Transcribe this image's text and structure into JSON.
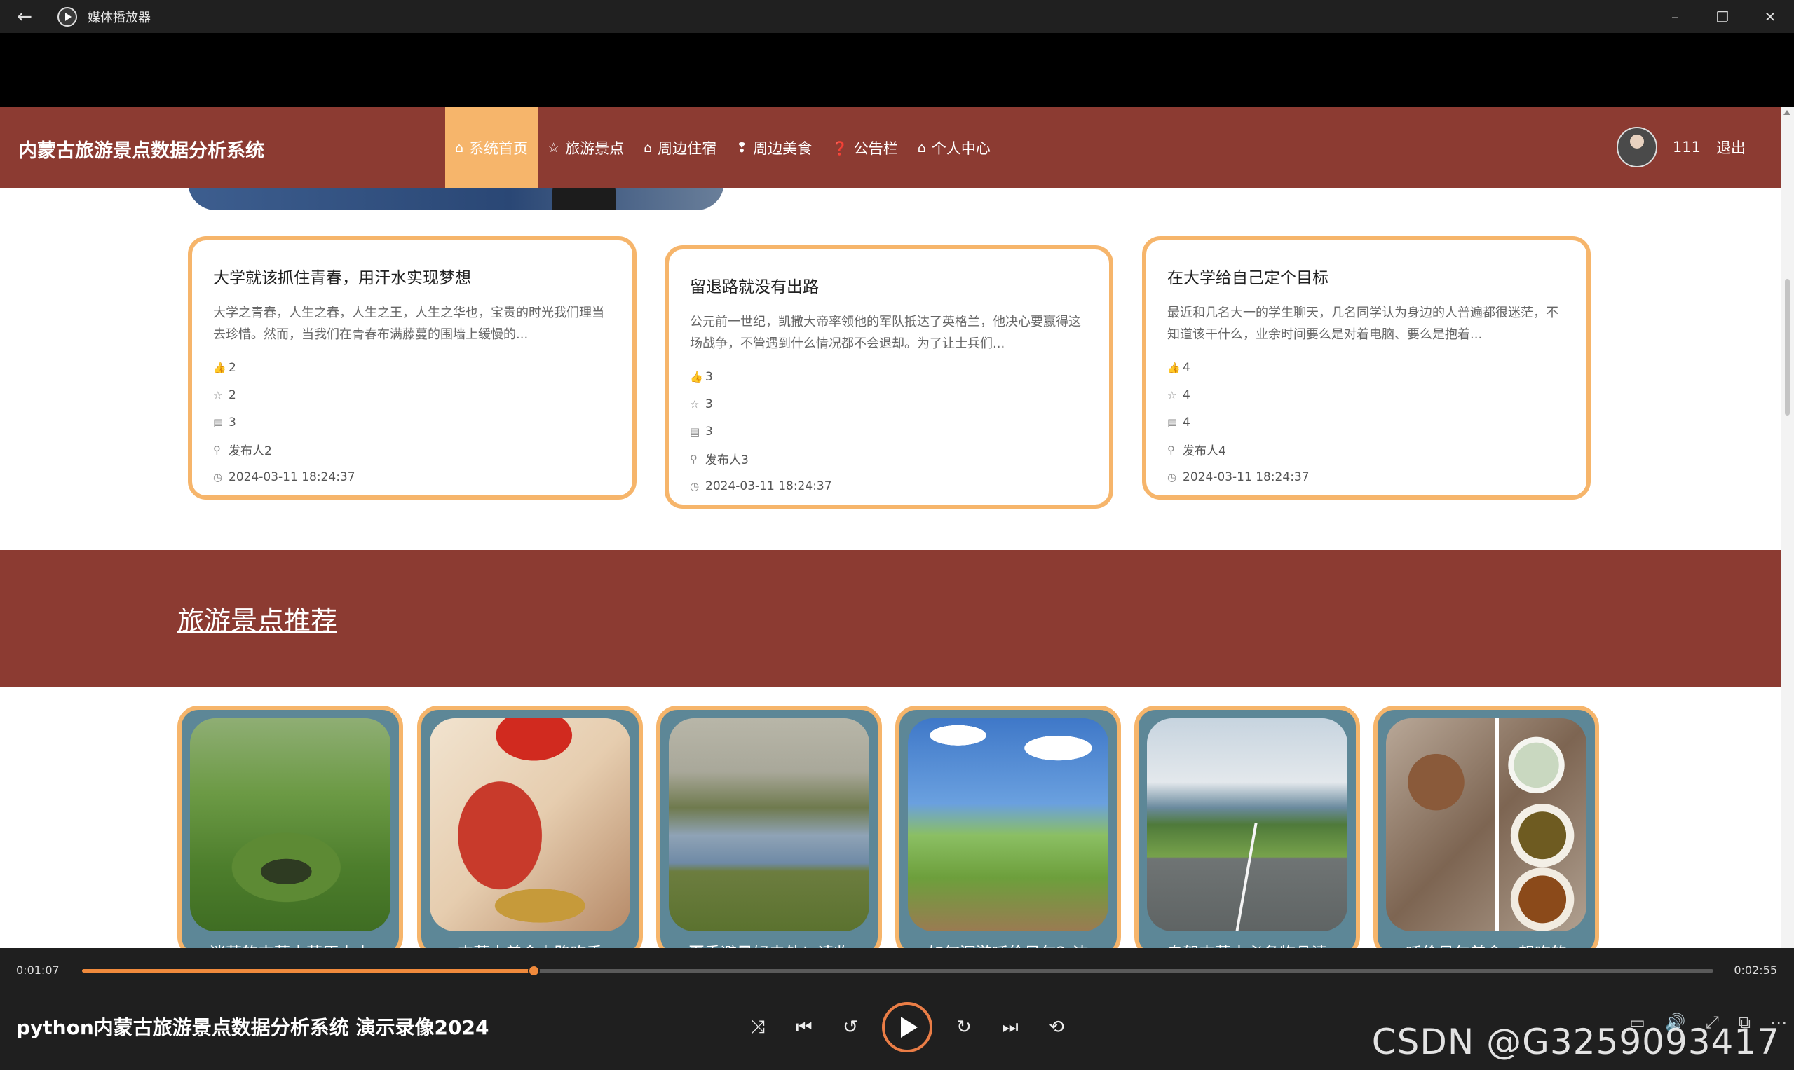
{
  "window": {
    "app_title": "媒体播放器",
    "back_icon": "←",
    "minimize_icon": "–",
    "maximize_icon": "❐",
    "close_icon": "✕"
  },
  "site": {
    "brand": "内蒙古旅游景点数据分析系统",
    "nav": [
      {
        "label": "系统首页",
        "icon": "⌂",
        "active": true
      },
      {
        "label": "旅游景点",
        "icon": "☆"
      },
      {
        "label": "周边住宿",
        "icon": "⌂"
      },
      {
        "label": "周边美食",
        "icon": "❢"
      },
      {
        "label": "公告栏",
        "icon": "❓"
      },
      {
        "label": "个人中心",
        "icon": "⌂"
      }
    ],
    "user": {
      "name": "111",
      "logout": "退出"
    }
  },
  "notices": [
    {
      "title": "大学就该抓住青春，用汗水实现梦想",
      "desc": "大学之青春，人生之春，人生之王，人生之华也，宝贵的时光我们理当去珍惜。然而，当我们在青春布满藤蔓的围墙上缓慢的...",
      "likes": "2",
      "favorites": "2",
      "comments": "3",
      "publisher": "发布人2",
      "time": "2024-03-11 18:24:37"
    },
    {
      "title": "留退路就没有出路",
      "desc": "公元前一世纪，凯撒大帝率领他的军队抵达了英格兰，他决心要赢得这场战争，不管遇到什么情况都不会退却。为了让士兵们...",
      "likes": "3",
      "favorites": "3",
      "comments": "3",
      "publisher": "发布人3",
      "time": "2024-03-11 18:24:37"
    },
    {
      "title": "在大学给自己定个目标",
      "desc": "最近和几名大一的学生聊天，几名同学认为身边的人普遍都很迷茫，不知道该干什么，业余时间要么是对着电脑、要么是抱着...",
      "likes": "4",
      "favorites": "4",
      "comments": "4",
      "publisher": "发布人4",
      "time": "2024-03-11 18:24:37"
    }
  ],
  "section": {
    "title": "旅游景点推荐"
  },
  "attractions": [
    {
      "caption": "迷落的内蒙古草原火山"
    },
    {
      "caption": "内蒙古美食｜路吃手"
    },
    {
      "caption": "夏季避暑好去处！请收"
    },
    {
      "caption": "如何深游呼伦贝尔？边"
    },
    {
      "caption": "自驾内蒙古必备物品清"
    },
    {
      "caption": "呼伦贝尔美食，想吃的"
    }
  ],
  "player": {
    "current_time": "0:01:07",
    "total_time": "0:02:55",
    "progress": 0.2773,
    "media_title": "python内蒙古旅游景点数据分析系统 演示录像2024",
    "watermark": "CSDN @G3259093417"
  },
  "colors": {
    "brand_red": "#8c3b32",
    "accent_orange": "#f6b56b",
    "progress_orange": "#f08a3c"
  }
}
